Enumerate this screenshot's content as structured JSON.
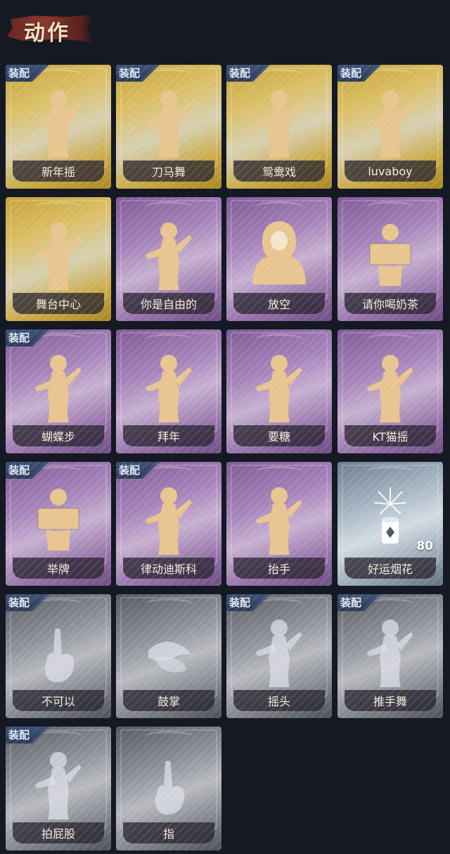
{
  "header": {
    "title": "动作"
  },
  "equip_label": "装配",
  "colors": {
    "gold": "#d4b44a",
    "purple": "#a684bb",
    "silver": "#aab8c6",
    "gray": "#8e9198",
    "figure_gold": "#e8c48e",
    "figure_faded": "#dcdde6",
    "badge": "#34476a"
  },
  "actions": [
    {
      "name": "新年摇",
      "tier": "gold",
      "equipped": true,
      "icon": "dance-figure-icon"
    },
    {
      "name": "刀马舞",
      "tier": "gold",
      "equipped": true,
      "icon": "dance-figure-icon"
    },
    {
      "name": "鸳鸯戏",
      "tier": "gold",
      "equipped": true,
      "icon": "dance-figure-icon"
    },
    {
      "name": "luvaboy",
      "tier": "gold",
      "equipped": true,
      "icon": "dance-figure-icon"
    },
    {
      "name": "舞台中心",
      "tier": "gold",
      "equipped": false,
      "icon": "dance-figure-icon"
    },
    {
      "name": "你是自由的",
      "tier": "purple",
      "equipped": false,
      "icon": "dance-figure-icon"
    },
    {
      "name": "放空",
      "tier": "purple",
      "equipped": false,
      "icon": "hooded-figure-icon"
    },
    {
      "name": "请你喝奶茶",
      "tier": "purple",
      "equipped": false,
      "icon": "sign-figure-icon"
    },
    {
      "name": "蝴蝶步",
      "tier": "purple",
      "equipped": true,
      "icon": "dance-figure-icon"
    },
    {
      "name": "拜年",
      "tier": "purple",
      "equipped": false,
      "icon": "dance-figure-icon"
    },
    {
      "name": "要糖",
      "tier": "purple",
      "equipped": false,
      "icon": "dance-figure-icon"
    },
    {
      "name": "KT猫摇",
      "tier": "purple",
      "equipped": false,
      "icon": "dance-figure-icon"
    },
    {
      "name": "举牌",
      "tier": "purple",
      "equipped": true,
      "icon": "sign-figure-icon"
    },
    {
      "name": "律动迪斯科",
      "tier": "purple",
      "equipped": true,
      "icon": "dance-figure-icon"
    },
    {
      "name": "抬手",
      "tier": "purple",
      "equipped": false,
      "icon": "dance-figure-icon"
    },
    {
      "name": "好运烟花",
      "tier": "silver",
      "equipped": false,
      "icon": "firework-icon",
      "count": "80"
    },
    {
      "name": "不可以",
      "tier": "gray",
      "equipped": true,
      "icon": "finger-wag-icon"
    },
    {
      "name": "鼓掌",
      "tier": "gray",
      "equipped": false,
      "icon": "clapping-hands-icon"
    },
    {
      "name": "摇头",
      "tier": "gray",
      "equipped": true,
      "icon": "dance-figure-icon"
    },
    {
      "name": "推手舞",
      "tier": "gray",
      "equipped": true,
      "icon": "dance-figure-icon"
    },
    {
      "name": "拍屁股",
      "tier": "gray",
      "equipped": true,
      "icon": "dance-figure-icon"
    },
    {
      "name": "指",
      "tier": "gray",
      "equipped": false,
      "icon": "pointing-hand-icon"
    }
  ]
}
